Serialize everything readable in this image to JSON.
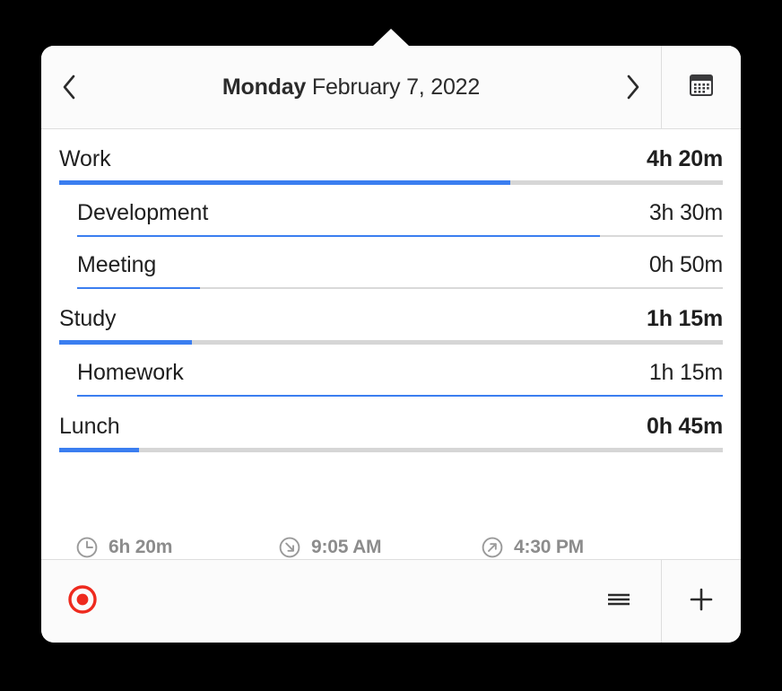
{
  "header": {
    "prev_icon": "chevron-left-icon",
    "next_icon": "chevron-right-icon",
    "calendar_icon": "calendar-icon",
    "day": "Monday",
    "date": " February 7, 2022"
  },
  "colors": {
    "accent_blue": "#3b7ef0",
    "track_gray": "#d6d6d6",
    "record_red": "#ee2a1e",
    "panel_bg": "#ffffff",
    "chrome_bg": "#fbfbfb",
    "text": "#1f1f1f",
    "muted_text": "#8c8c8c"
  },
  "entries": [
    {
      "name": "Work",
      "duration": "4h 20m",
      "level": "category",
      "percent": 68
    },
    {
      "name": "Development",
      "duration": "3h 30m",
      "level": "sub",
      "percent": 81
    },
    {
      "name": "Meeting",
      "duration": "0h 50m",
      "level": "sub",
      "percent": 19
    },
    {
      "name": "Study",
      "duration": "1h 15m",
      "level": "category",
      "percent": 20
    },
    {
      "name": "Homework",
      "duration": "1h 15m",
      "level": "sub",
      "percent": 100
    },
    {
      "name": "Lunch",
      "duration": "0h 45m",
      "level": "category",
      "percent": 12
    }
  ],
  "stats": [
    {
      "icon": "clock-icon",
      "value": "6h 20m"
    },
    {
      "icon": "arrow-down-right-icon",
      "value": "9:05 AM"
    },
    {
      "icon": "arrow-up-right-icon",
      "value": "4:30 PM"
    }
  ],
  "footer": {
    "record_icon": "record-icon",
    "menu_icon": "hamburger-menu-icon",
    "add_icon": "plus-icon"
  }
}
